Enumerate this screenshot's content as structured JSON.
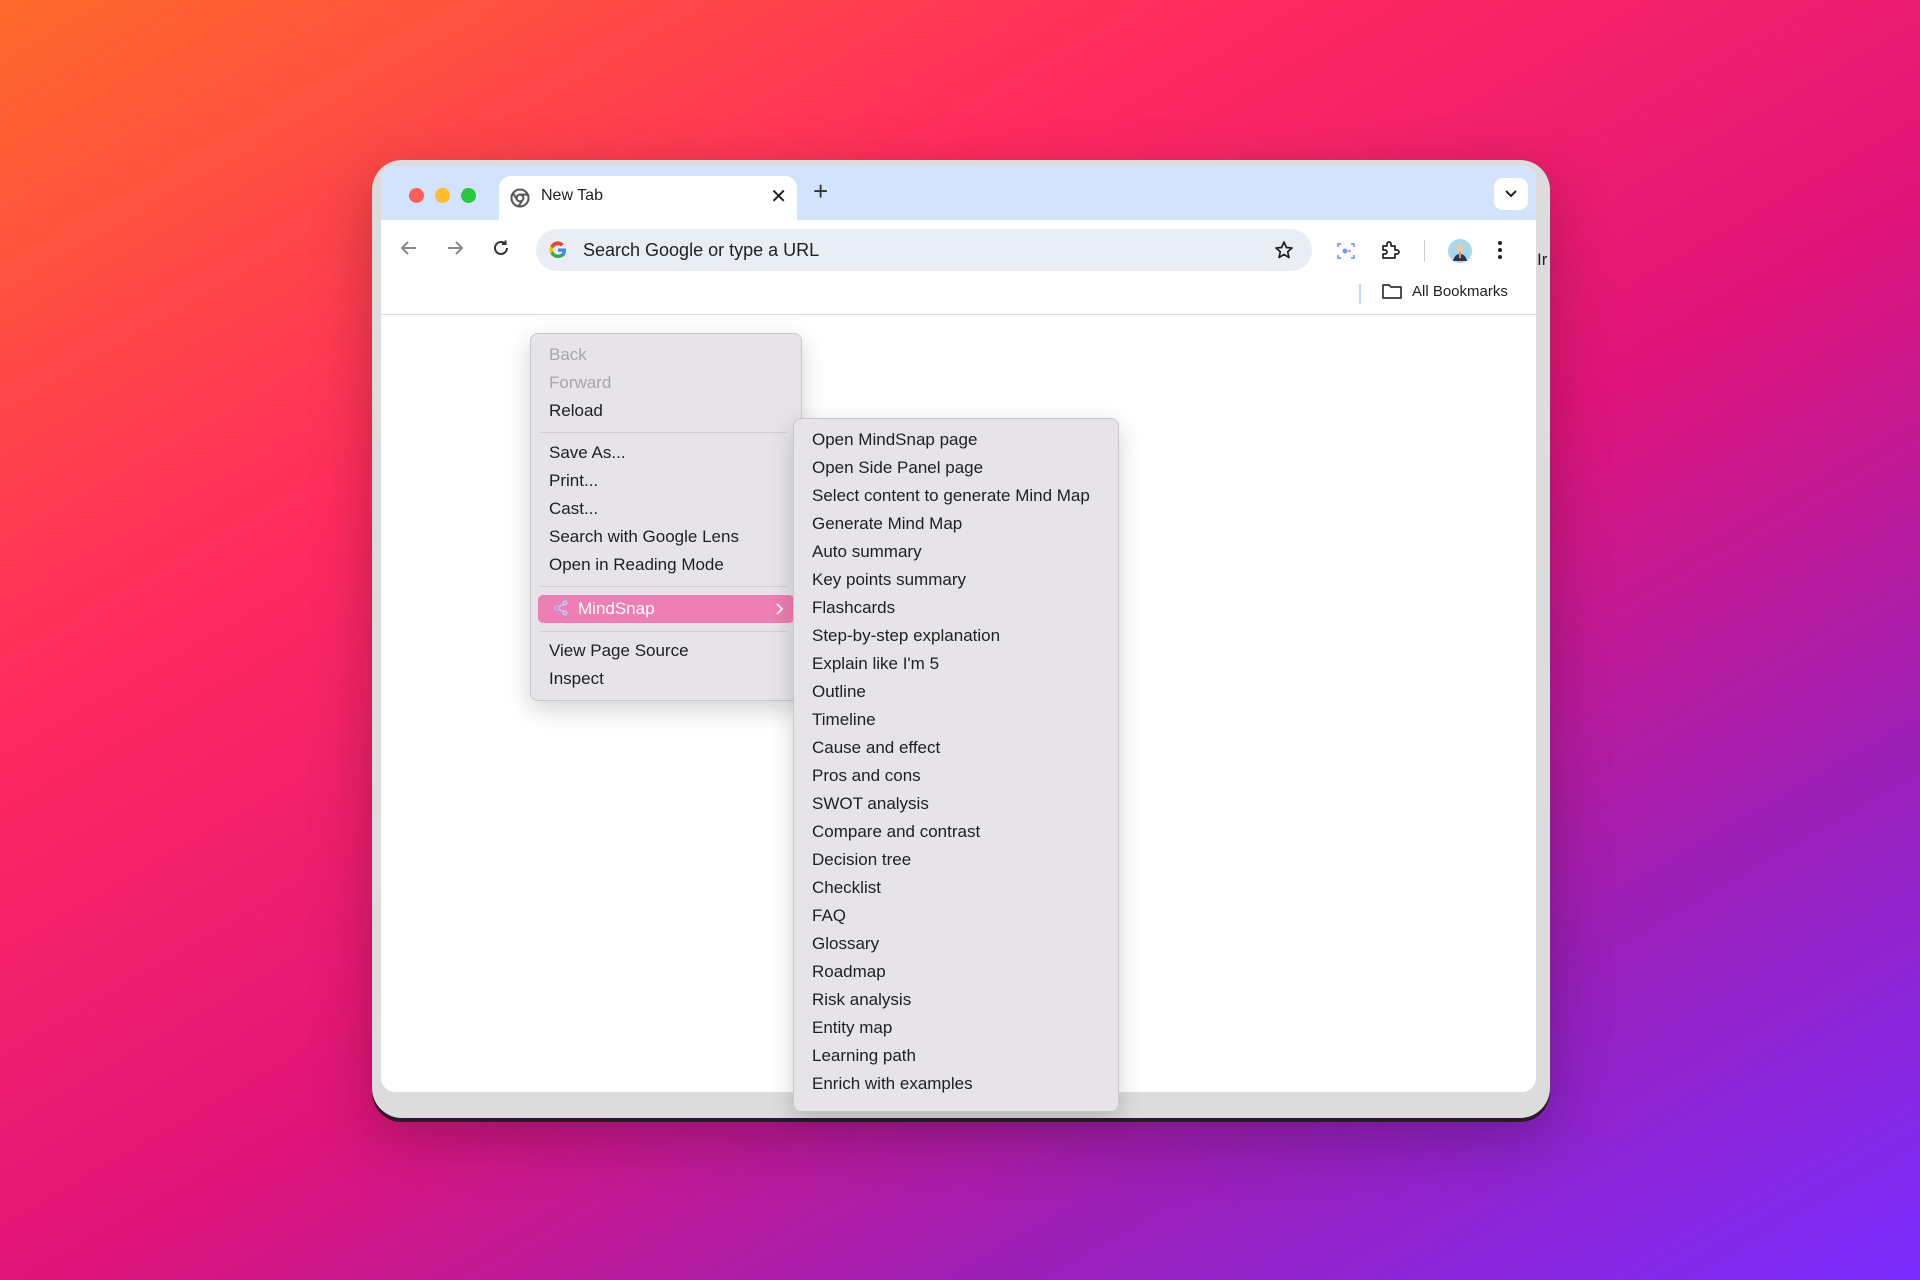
{
  "browser": {
    "tab": {
      "title": "New Tab",
      "close": "✕"
    },
    "new_tab": "+",
    "omnibox": {
      "placeholder": "Search Google or type a URL"
    },
    "bookmarks": {
      "all_bookmarks": "All Bookmarks"
    },
    "edge_text": "Ir"
  },
  "context_menu": {
    "items": [
      {
        "label": "Back",
        "enabled": false
      },
      {
        "label": "Forward",
        "enabled": false
      },
      {
        "label": "Reload",
        "enabled": true
      },
      {
        "label": "Save As...",
        "enabled": true
      },
      {
        "label": "Print...",
        "enabled": true
      },
      {
        "label": "Cast...",
        "enabled": true
      },
      {
        "label": "Search with Google Lens",
        "enabled": true
      },
      {
        "label": "Open in Reading Mode",
        "enabled": true
      },
      {
        "label": "MindSnap",
        "enabled": true,
        "highlighted": true,
        "submenu": true
      },
      {
        "label": "View Page Source",
        "enabled": true
      },
      {
        "label": "Inspect",
        "enabled": true
      }
    ]
  },
  "mindsnap_submenu": {
    "items": [
      "Open MindSnap page",
      "Open Side Panel page",
      "Select content to generate Mind Map",
      "Generate Mind Map",
      "Auto summary",
      "Key points summary",
      "Flashcards",
      "Step-by-step explanation",
      "Explain like I'm 5",
      "Outline",
      "Timeline",
      "Cause and effect",
      "Pros and cons",
      "SWOT analysis",
      "Compare and contrast",
      "Decision tree",
      "Checklist",
      "FAQ",
      "Glossary",
      "Roadmap",
      "Risk analysis",
      "Entity map",
      "Learning path",
      "Enrich with examples"
    ]
  },
  "colors": {
    "tabbar": "#d3e3fd",
    "omnibox": "#e9eef6",
    "menu_bg": "#e6e4e8",
    "highlight": "#ee7eb3"
  }
}
